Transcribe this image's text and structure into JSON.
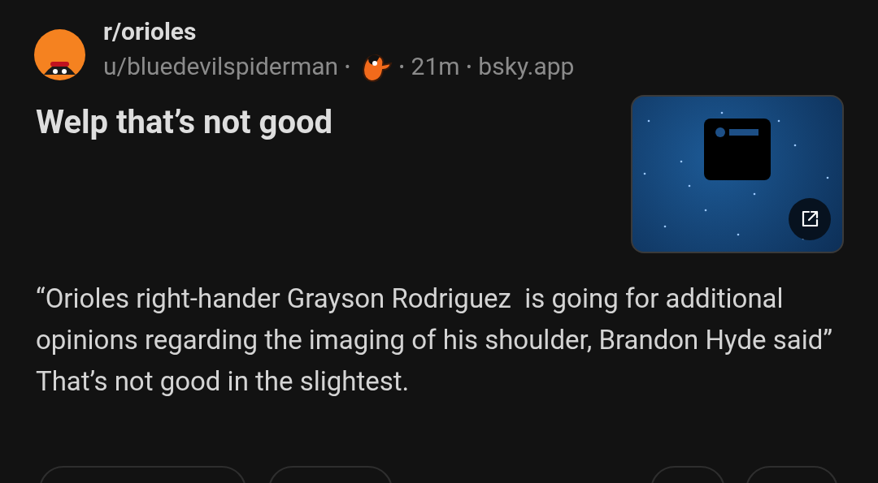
{
  "post": {
    "subreddit": "r/orioles",
    "author": "u/bluedevilspiderman",
    "separator_1": "•",
    "separator_2": "•",
    "age": "21m",
    "separator_3": "•",
    "domain": "bsky.app",
    "title": "Welp that’s not good",
    "body": "“Orioles right-hander Grayson Rodriguez  is going for additional opinions regarding the imaging of his shoulder, Brandon Hyde said” That’s not good in the slightest."
  }
}
